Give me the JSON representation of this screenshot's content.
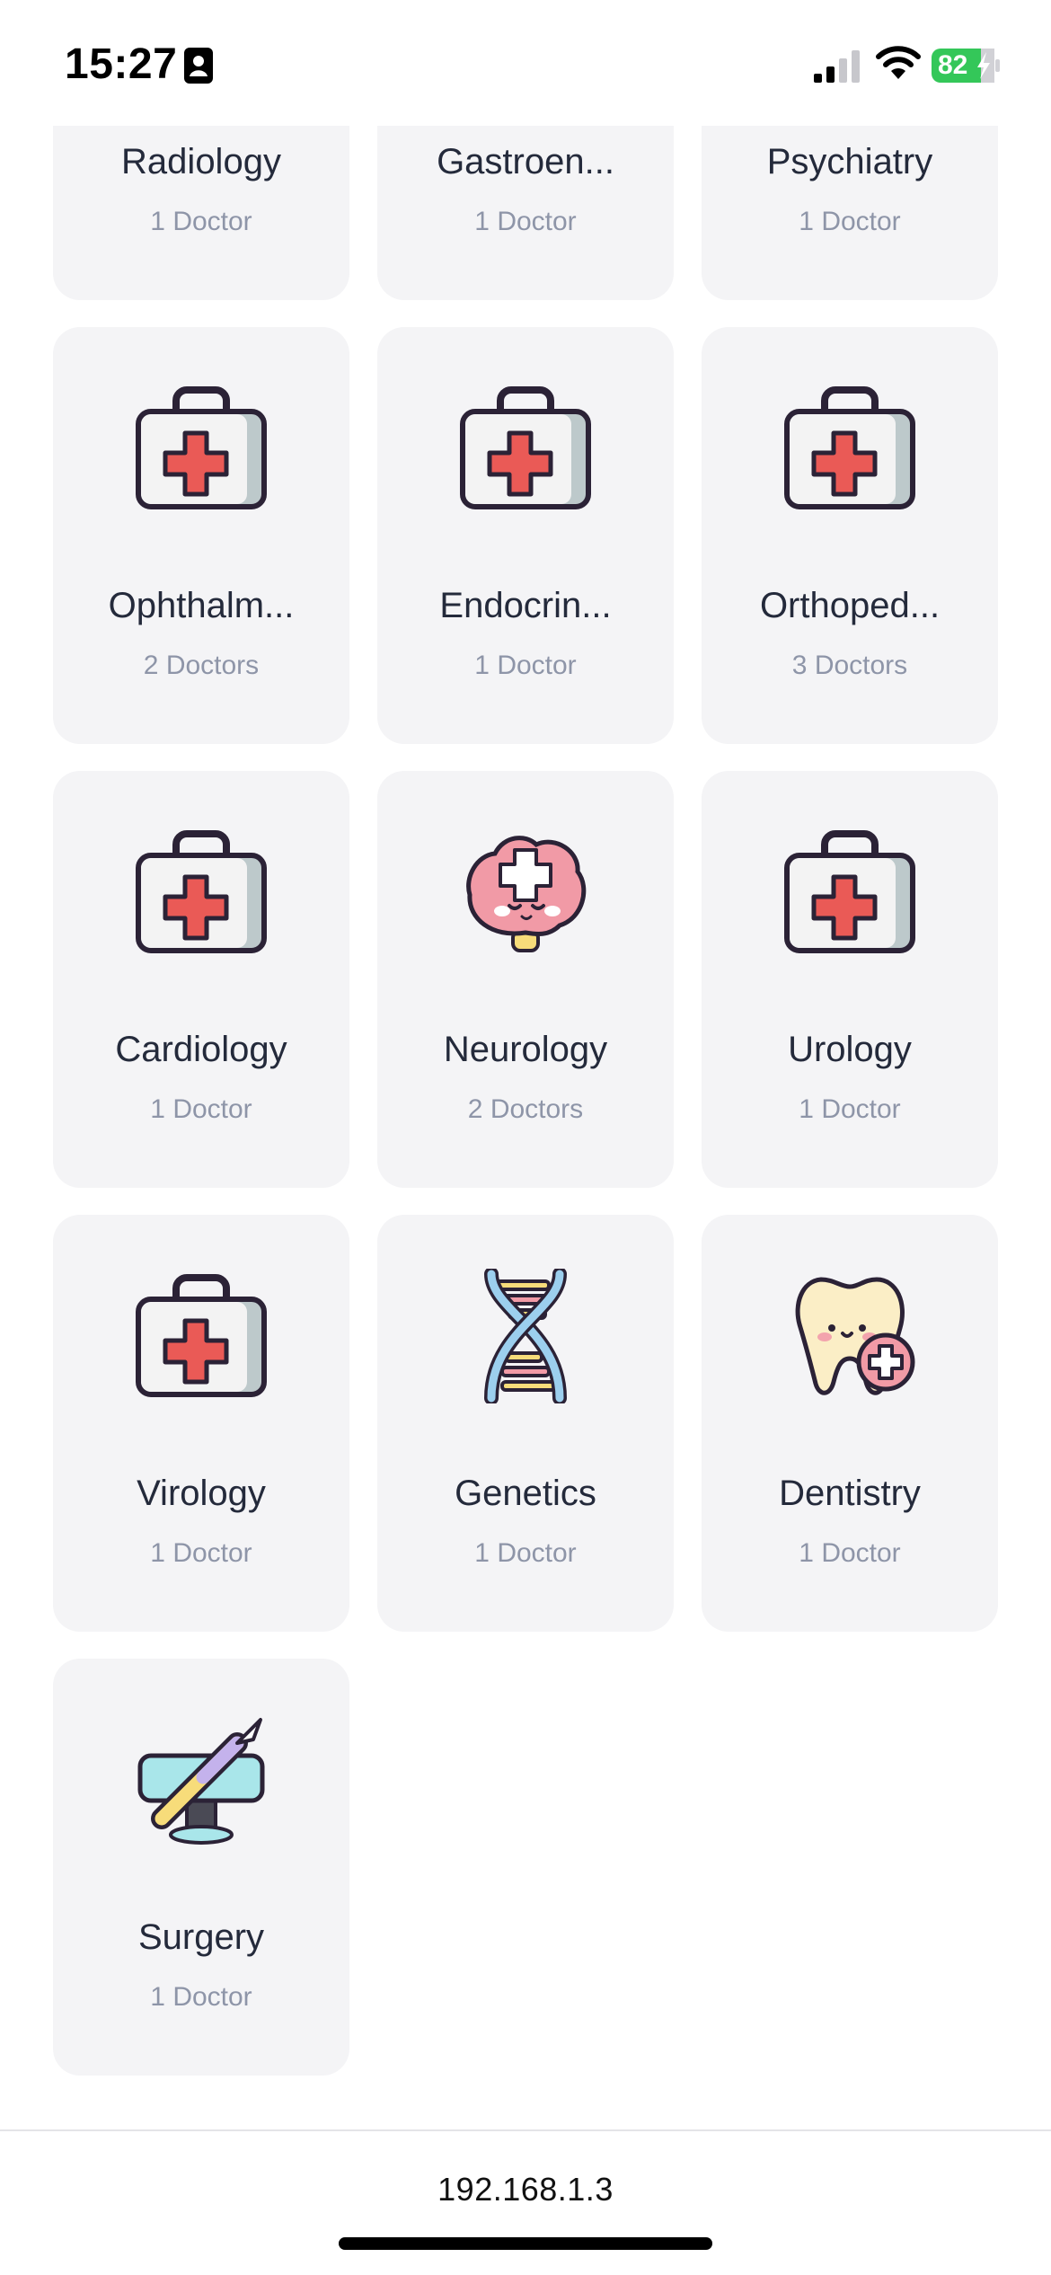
{
  "status_bar": {
    "time": "15:27",
    "battery": "82",
    "icons": [
      "contact-card-icon",
      "cellular-signal-icon",
      "wifi-icon",
      "battery-charging-icon"
    ],
    "battery_color": "#34c759"
  },
  "specialties": [
    {
      "name": "Radiology",
      "count": "1 Doctor",
      "icon": "medical-kit-icon"
    },
    {
      "name": "Gastroen...",
      "count": "1 Doctor",
      "icon": "medical-kit-icon"
    },
    {
      "name": "Psychiatry",
      "count": "1 Doctor",
      "icon": "medical-kit-icon"
    },
    {
      "name": "Ophthalm...",
      "count": "2 Doctors",
      "icon": "medical-kit-icon"
    },
    {
      "name": "Endocrin...",
      "count": "1 Doctor",
      "icon": "medical-kit-icon"
    },
    {
      "name": "Orthoped...",
      "count": "3 Doctors",
      "icon": "medical-kit-icon"
    },
    {
      "name": "Cardiology",
      "count": "1 Doctor",
      "icon": "medical-kit-icon"
    },
    {
      "name": "Neurology",
      "count": "2 Doctors",
      "icon": "brain-icon"
    },
    {
      "name": "Urology",
      "count": "1 Doctor",
      "icon": "medical-kit-icon"
    },
    {
      "name": "Virology",
      "count": "1 Doctor",
      "icon": "medical-kit-icon"
    },
    {
      "name": "Genetics",
      "count": "1 Doctor",
      "icon": "dna-icon"
    },
    {
      "name": "Dentistry",
      "count": "1 Doctor",
      "icon": "tooth-icon"
    },
    {
      "name": "Surgery",
      "count": "1 Doctor",
      "icon": "scalpel-icon"
    }
  ],
  "browser": {
    "url": "192.168.1.3"
  },
  "colors": {
    "card_background": "#f4f4f6",
    "title_text": "#242a3b",
    "count_text": "#8e95a8",
    "kit_cross": "#ea5a56"
  }
}
